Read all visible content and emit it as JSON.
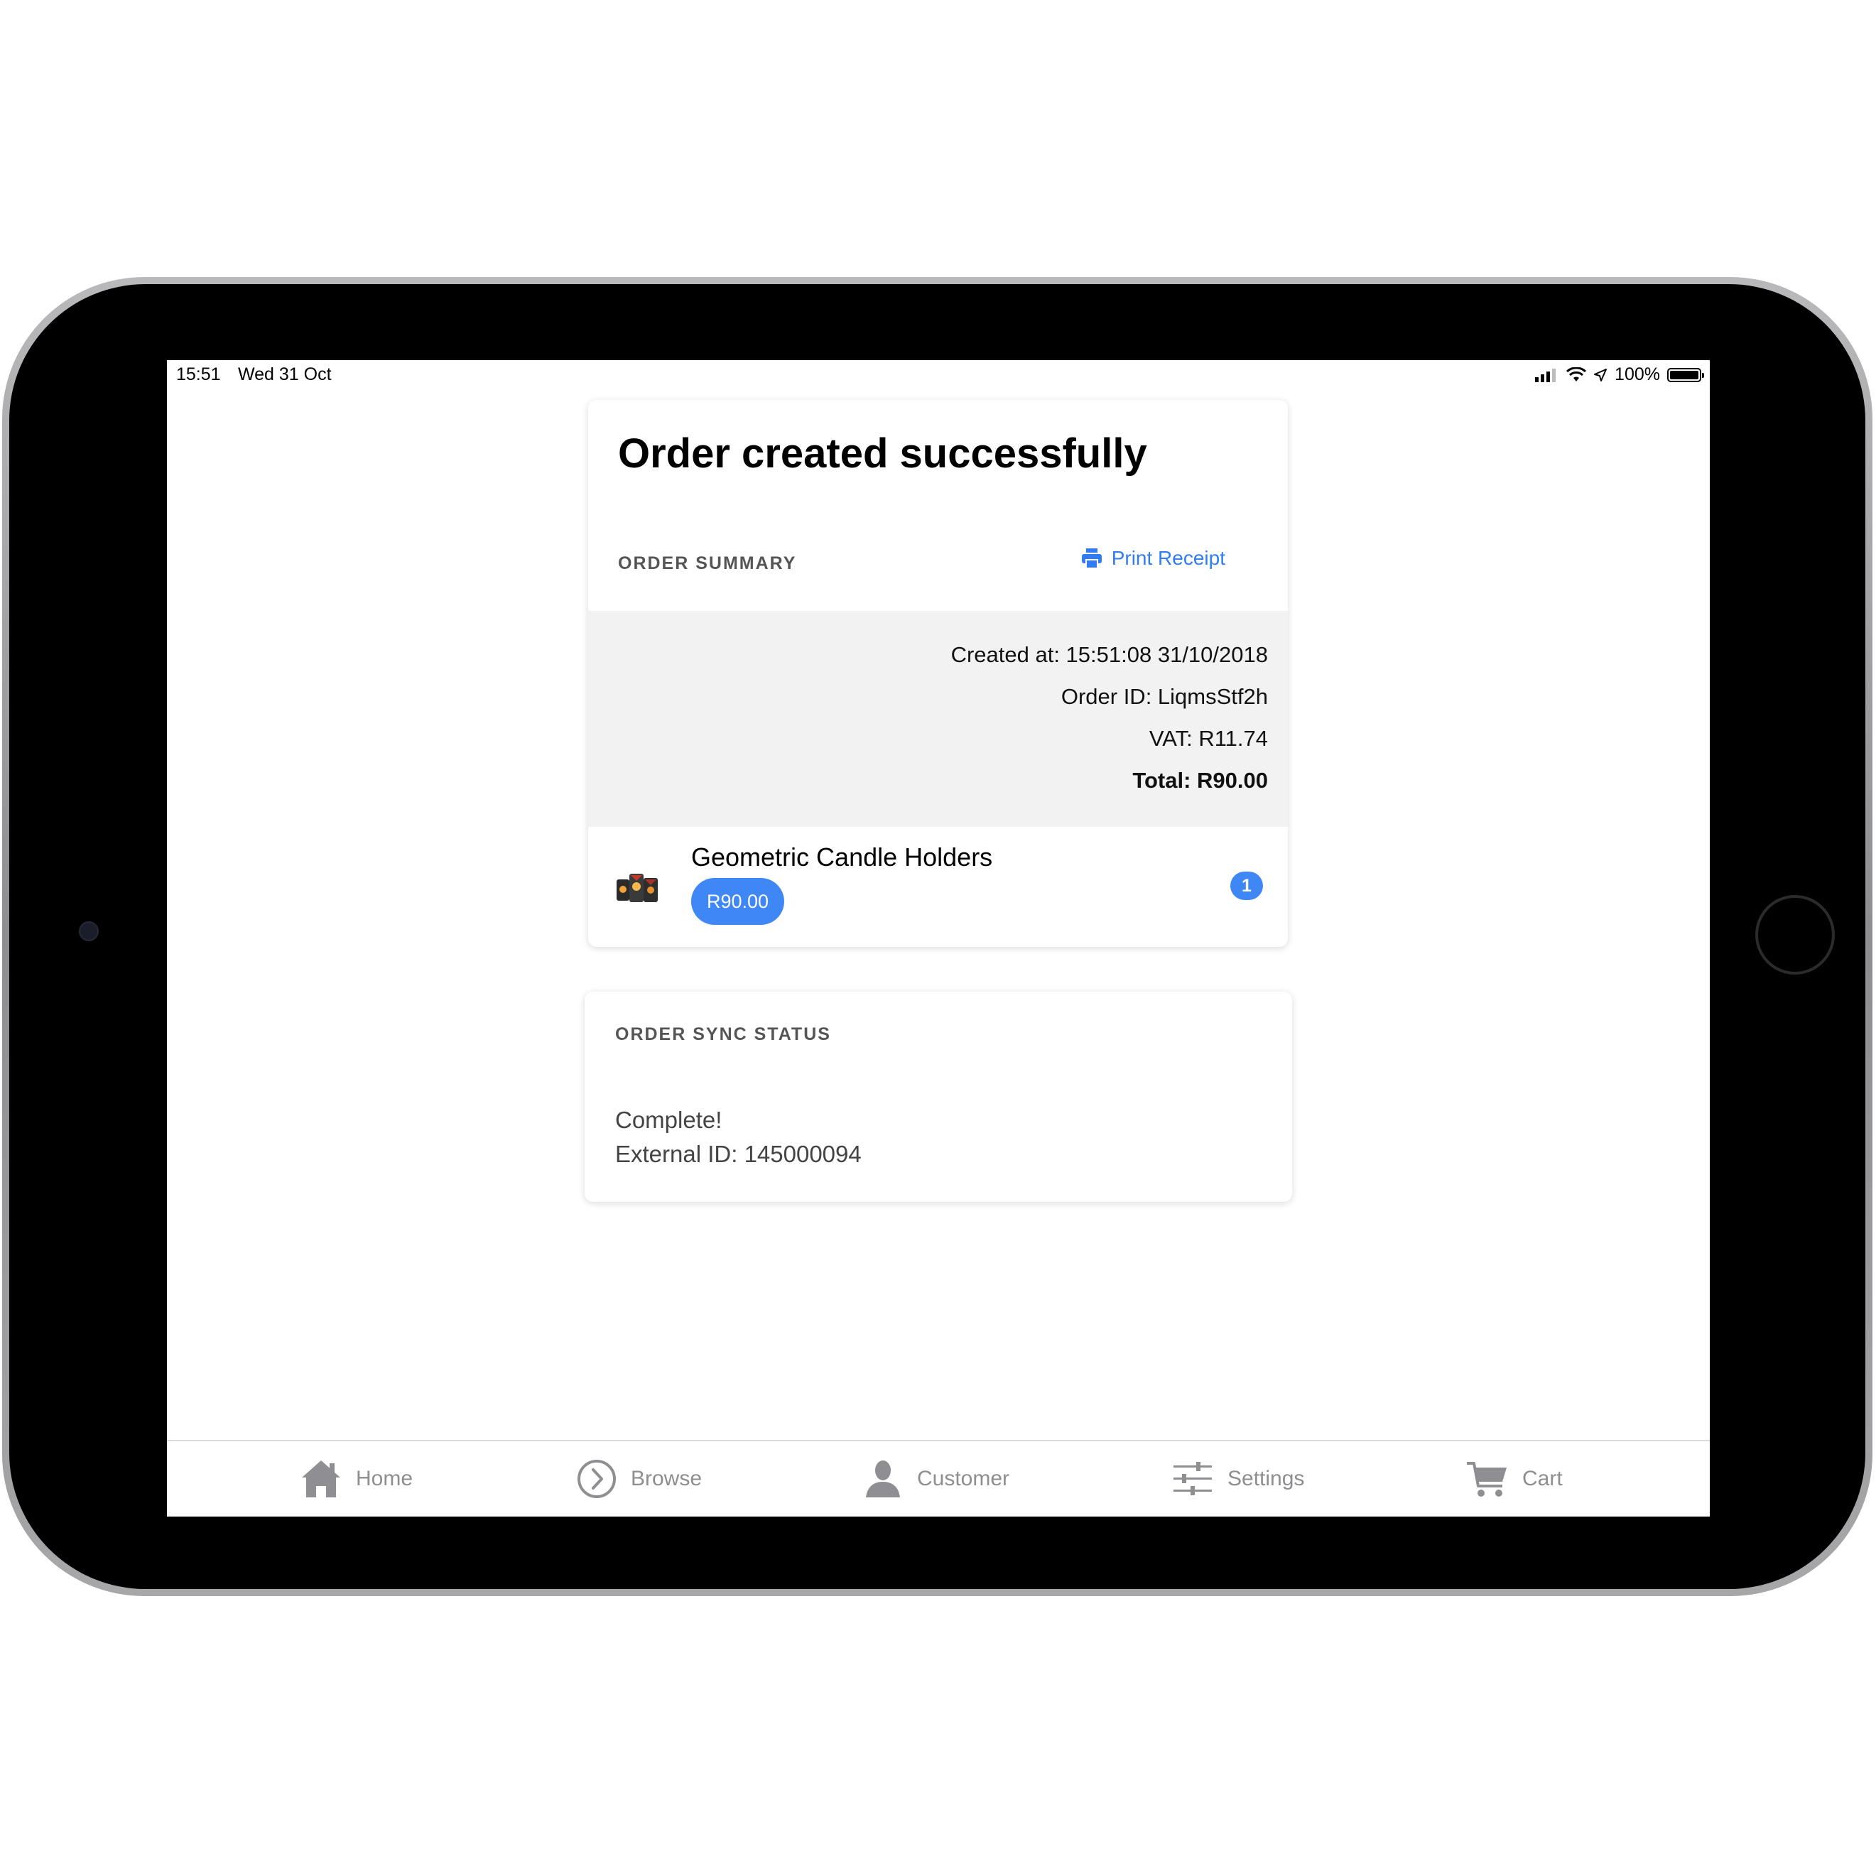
{
  "status_bar": {
    "time": "15:51",
    "date": "Wed 31 Oct",
    "battery": "100%",
    "battery_level": 1.0,
    "icons": [
      "signal-icon",
      "wifi-icon",
      "location-icon",
      "battery-icon"
    ]
  },
  "order": {
    "title": "Order created successfully",
    "summary_label": "ORDER SUMMARY",
    "print_receipt_label": "Print Receipt",
    "created_at": "Created at: 15:51:08 31/10/2018",
    "order_id": "Order ID: LiqmsStf2h",
    "vat": "VAT: R11.74",
    "total": "Total: R90.00",
    "items": [
      {
        "name": "Geometric Candle Holders",
        "price": "R90.00",
        "quantity": "1"
      }
    ]
  },
  "sync": {
    "label": "ORDER SYNC STATUS",
    "status": "Complete!",
    "external_id": "External ID: 145000094"
  },
  "tabs": [
    {
      "label": "Home",
      "icon": "home-icon"
    },
    {
      "label": "Browse",
      "icon": "chevron-circle-icon"
    },
    {
      "label": "Customer",
      "icon": "person-icon"
    },
    {
      "label": "Settings",
      "icon": "sliders-icon"
    },
    {
      "label": "Cart",
      "icon": "cart-icon"
    }
  ],
  "colors": {
    "accent": "#3f87f5",
    "link": "#2f7cf6",
    "tab_inactive": "#8e8e93",
    "panel_bg": "#f2f2f2"
  }
}
